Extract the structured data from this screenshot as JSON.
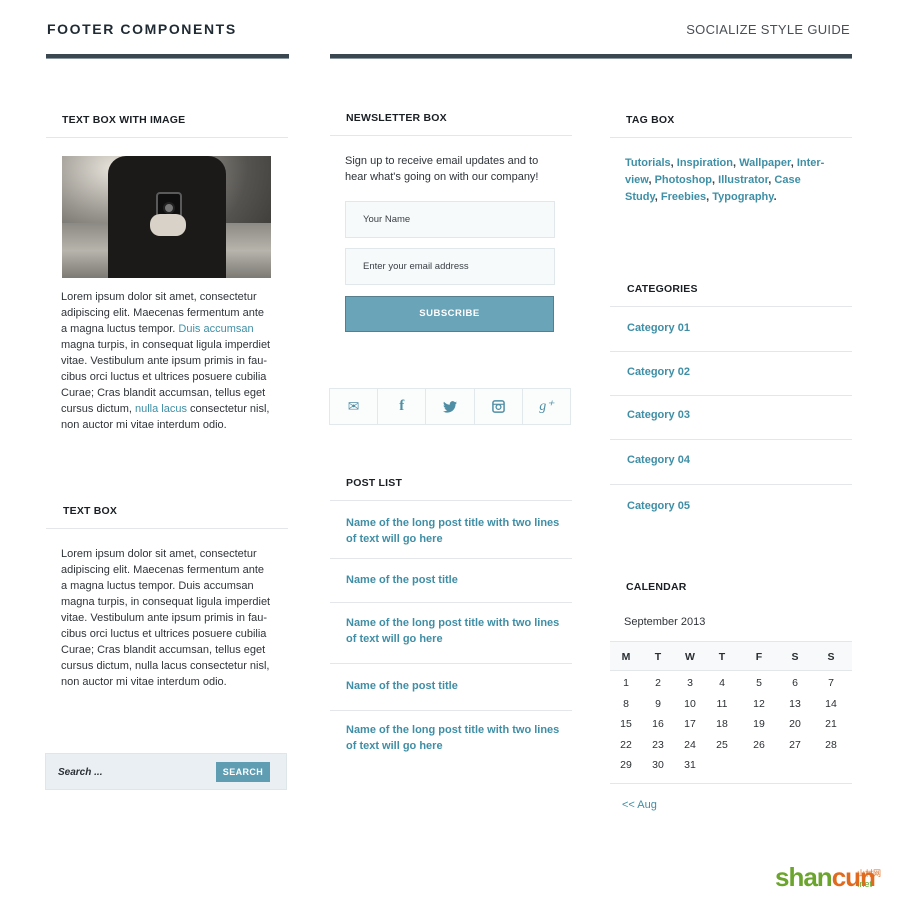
{
  "header": {
    "title": "FOOTER COMPONENTS",
    "guide": "SOCIALIZE STYLE GUIDE"
  },
  "text_box_with_image": {
    "title": "TEXT BOX WITH IMAGE",
    "image_alt": "Person holding a vintage twin-lens camera",
    "body": [
      {
        "text": "Lorem ipsum dolor sit amet, consectetur adipiscing elit. Maecenas fermentum ante a magna luctus tempor. ",
        "link": false
      },
      {
        "text": "Duis accumsan",
        "link": true
      },
      {
        "text": " magna turpis, in consequat ligula imperdiet vitae. Vestibulum ante ipsum primis in fau-cibus orci luctus et ultrices posuere cubilia Curae; Cras blandit accumsan, tellus eget cursus dictum, ",
        "link": false
      },
      {
        "text": "nulla lacus",
        "link": true
      },
      {
        "text": " consectetur nisl, non auctor mi vitae interdum odio.",
        "link": false
      }
    ]
  },
  "text_box": {
    "title": "TEXT BOX",
    "body": "Lorem ipsum dolor sit amet, consectetur adipiscing elit. Maecenas fermentum ante a magna luctus tempor. Duis accumsan magna turpis, in consequat ligula imperdiet vitae. Vestibulum ante ipsum primis in fau-cibus orci luctus et ultrices posuere cubilia Curae; Cras blandit accumsan, tellus eget cursus dictum, nulla lacus consectetur nisl, non auctor mi vitae interdum odio."
  },
  "search": {
    "placeholder": "Search ...",
    "button": "SEARCH"
  },
  "newsletter": {
    "title": "NEWSLETTER BOX",
    "description": "Sign up to receive email updates and to hear what's going on with our company!",
    "name_placeholder": "Your Name",
    "email_placeholder": "Enter your email address",
    "subscribe": "SUBSCRIBE"
  },
  "social": [
    {
      "name": "email",
      "glyph": "✉"
    },
    {
      "name": "facebook",
      "glyph": "f"
    },
    {
      "name": "twitter",
      "glyph": "🐦"
    },
    {
      "name": "instagram",
      "glyph": "◙"
    },
    {
      "name": "google-plus",
      "glyph": "g⁺"
    }
  ],
  "post_list": {
    "title": "POST LIST",
    "items": [
      "Name of the long post title with two lines of text will go here",
      "Name of the post title",
      "Name of the long post title with two lines of text will go here",
      "Name of the post title",
      "Name of the long post title with two lines of text will go here"
    ]
  },
  "tag_box": {
    "title": "TAG BOX",
    "tags": [
      "Tutorials",
      "Inspiration",
      "Wallpaper",
      "Inter-view",
      "Photoshop",
      "Illustrator",
      "Case Study",
      "Freebies",
      "Typography"
    ]
  },
  "categories": {
    "title": "CATEGORIES",
    "items": [
      "Category 01",
      "Category 02",
      "Category 03",
      "Category 04",
      "Category 05"
    ]
  },
  "calendar": {
    "title": "CALENDAR",
    "month": "September 2013",
    "weekdays": [
      "M",
      "T",
      "W",
      "T",
      "F",
      "S",
      "S"
    ],
    "weeks": [
      [
        "1",
        "2",
        "3",
        "4",
        "5",
        "6",
        "7"
      ],
      [
        "8",
        "9",
        "10",
        "11",
        "12",
        "13",
        "14"
      ],
      [
        "15",
        "16",
        "17",
        "18",
        "19",
        "20",
        "21"
      ],
      [
        "22",
        "23",
        "24",
        "25",
        "26",
        "27",
        "28"
      ],
      [
        "29",
        "30",
        "31",
        "",
        "",
        "",
        ""
      ]
    ],
    "prev": "<< Aug"
  },
  "watermark": {
    "part1": "shan",
    "part2": "cun",
    "sub": "山村网",
    "net": ".net"
  },
  "colors": {
    "accent": "#5f9db3",
    "link": "#3f8ea5",
    "rule": "#3a4650"
  }
}
